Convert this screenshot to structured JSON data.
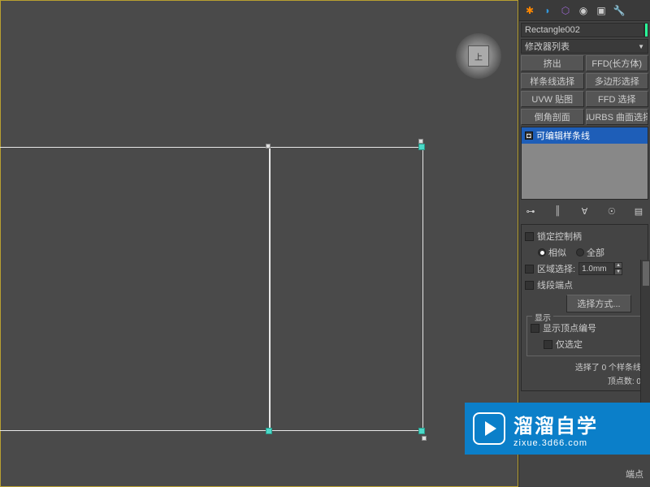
{
  "viewport": {
    "viewcube_label": "上"
  },
  "object": {
    "name": "Rectangle002",
    "color": "#2aff9a"
  },
  "modifier_list_label": "修改器列表",
  "buttons": {
    "extrude": "挤出",
    "ffd_box": "FFD(长方体)",
    "spline_select": "样条线选择",
    "poly_select": "多边形选择",
    "uvw_map": "UVW 贴图",
    "ffd_select": "FFD 选择",
    "chamfer_profile": "倒角剖面",
    "nurbs_surface": "NURBS 曲面选择"
  },
  "stack": {
    "item": "可编辑样条线"
  },
  "selection": {
    "lock_handles": "锁定控制柄",
    "similar": "相似",
    "all": "全部",
    "area_select": "区域选择:",
    "area_value": "1.0mm",
    "segment_end": "线段端点",
    "select_mode": "选择方式..."
  },
  "display": {
    "title": "显示",
    "show_vertex_numbers": "显示顶点编号",
    "selected_only": "仅选定"
  },
  "status": {
    "spline_count": "选择了 0 个样条线",
    "vertex_count": "顶点数: 0"
  },
  "watermark": {
    "main": "溜溜自学",
    "sub": "zixue.3d66.com"
  },
  "bottom_hint": "端点"
}
